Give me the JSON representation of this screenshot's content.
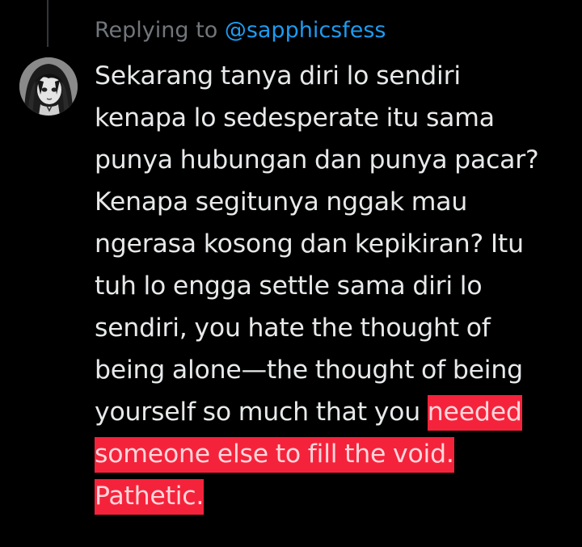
{
  "reply_context": {
    "prefix": "Replying to",
    "handle": "@sapphicsfess"
  },
  "tweet": {
    "avatar_icon": "anime-avatar-image",
    "lines": [
      "Sekarang tanya diri lo sendiri",
      "kenapa lo sedesperate itu sama",
      "punya hubungan dan punya pacar?",
      "Kenapa segitunya nggak mau",
      "ngerasa kosong dan kepikiran? Itu",
      "tuh lo engga settle sama diri lo",
      "sendiri, you hate the thought of",
      "being alone—the thought of being"
    ],
    "line9_plain": "yourself so much that you ",
    "line9_highlight": "needed",
    "line10_highlight": "someone else to fill the void.",
    "line11_highlight": "Pathetic."
  },
  "colors": {
    "background": "#000000",
    "text": "#e7e9ea",
    "muted": "#71767b",
    "link": "#1d9bf0",
    "highlight": "#f4233b"
  }
}
